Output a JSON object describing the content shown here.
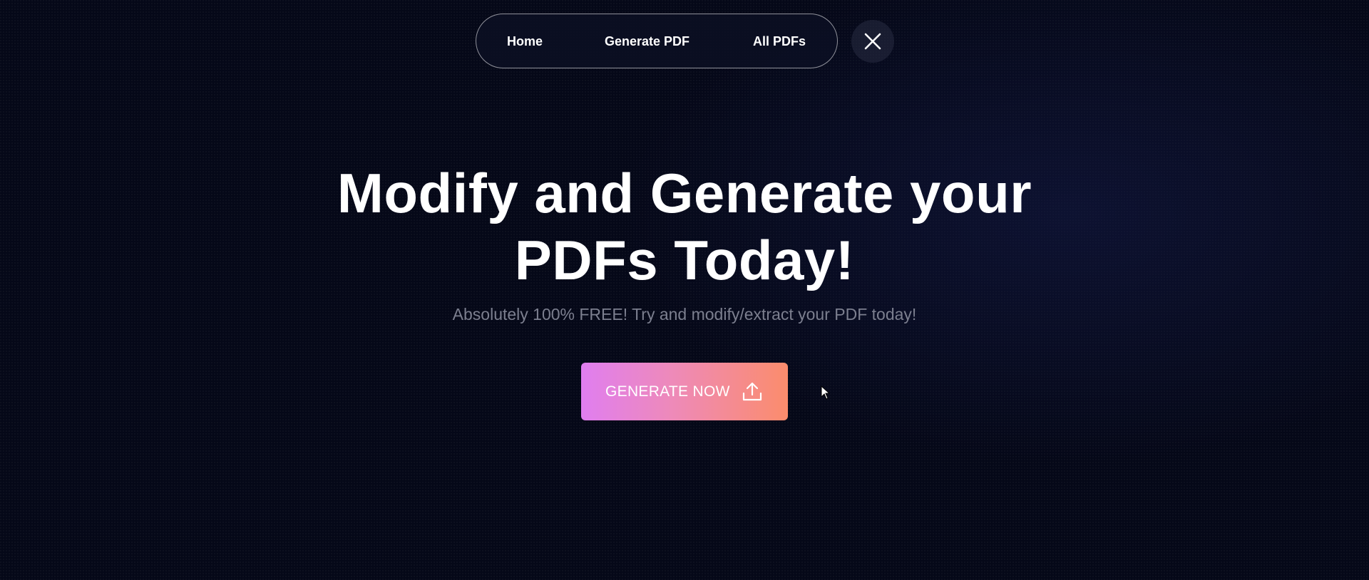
{
  "nav": {
    "items": [
      {
        "label": "Home"
      },
      {
        "label": "Generate PDF"
      },
      {
        "label": "All PDFs"
      }
    ],
    "close_icon": "close-icon"
  },
  "hero": {
    "title_line1": "Modify and Generate your",
    "title_line2": "PDFs Today!",
    "subtitle": "Absolutely 100% FREE! Try and modify/extract your PDF today!",
    "cta_label": "GENERATE NOW",
    "cta_icon": "upload-icon"
  },
  "colors": {
    "background": "#050818",
    "cta_gradient_start": "#e07ef0",
    "cta_gradient_end": "#fb8c6c",
    "subtitle": "#7c7f8f"
  }
}
